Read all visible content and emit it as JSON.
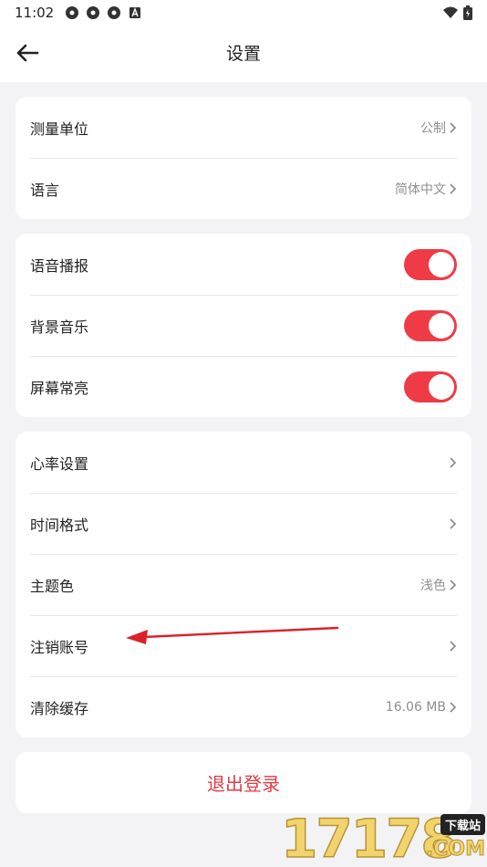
{
  "status_bar": {
    "time": "11:02"
  },
  "header": {
    "title": "设置"
  },
  "sections": [
    {
      "rows": [
        {
          "label": "测量单位",
          "value": "公制"
        },
        {
          "label": "语言",
          "value": "简体中文"
        }
      ]
    },
    {
      "rows": [
        {
          "label": "语音播报",
          "on": true
        },
        {
          "label": "背景音乐",
          "on": true
        },
        {
          "label": "屏幕常亮",
          "on": true
        }
      ]
    },
    {
      "rows": [
        {
          "label": "心率设置",
          "value": ""
        },
        {
          "label": "时间格式",
          "value": ""
        },
        {
          "label": "主题色",
          "value": "浅色"
        },
        {
          "label": "注销账号",
          "value": ""
        },
        {
          "label": "清除缓存",
          "value": "16.06 MB"
        }
      ]
    }
  ],
  "logout": {
    "label": "退出登录"
  },
  "colors": {
    "accent": "#ee3b46",
    "logout_text": "#e23a45",
    "background": "#f3f3f5"
  },
  "watermark": {
    "digits": "17178",
    "tag": "下载站",
    "suffix": ".COM"
  }
}
